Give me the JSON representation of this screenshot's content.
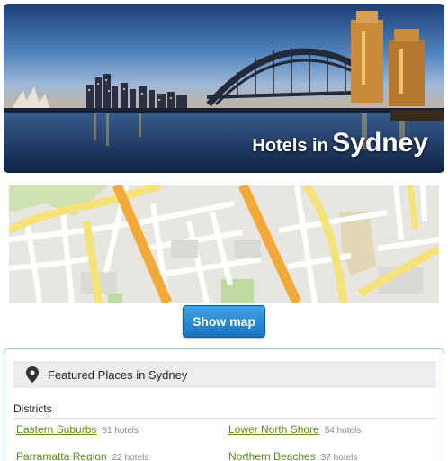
{
  "hero": {
    "title_prefix": "Hotels in",
    "title_city": "Sydney"
  },
  "map": {
    "button_label": "Show map"
  },
  "featured": {
    "header": "Featured Places in Sydney",
    "section_label": "Districts",
    "districts": [
      {
        "name": "Eastern Suburbs",
        "count": "81 hotels"
      },
      {
        "name": "Lower North Shore",
        "count": "54 hotels"
      },
      {
        "name": "Parramatta Region",
        "count": "22 hotels"
      },
      {
        "name": "Northern Beaches",
        "count": "37 hotels"
      }
    ]
  },
  "colors": {
    "link": "#5b8a1c",
    "button": "#1b74c0",
    "panel_border": "#9bbfe0"
  }
}
